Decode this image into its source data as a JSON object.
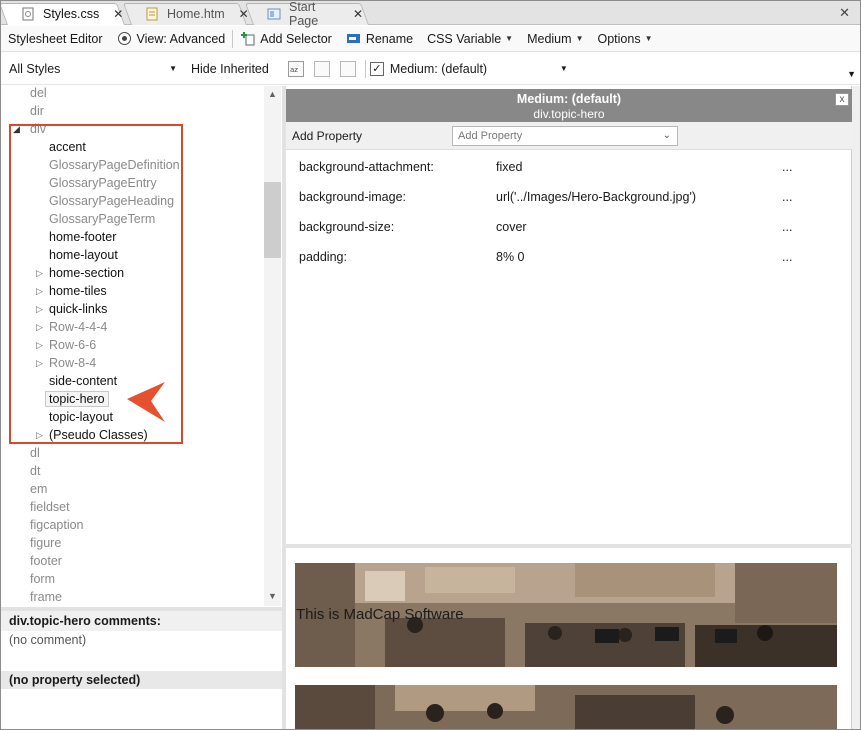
{
  "tabs": [
    {
      "label": "Styles.css",
      "close": "✕",
      "active": true
    },
    {
      "label": "Home.htm",
      "close": "✕",
      "active": false
    },
    {
      "label": "Start Page",
      "close": "✕",
      "active": false
    }
  ],
  "tabs_close_all": "✕",
  "toolbar": {
    "editor_label": "Stylesheet Editor",
    "view_label": "View: Advanced",
    "add_selector_label": "Add Selector",
    "rename_label": "Rename",
    "css_variable_label": "CSS Variable",
    "medium_label": "Medium",
    "options_label": "Options"
  },
  "filterbar": {
    "filter_value": "All Styles",
    "hide_inherited_label": "Hide Inherited",
    "medium_value": "Medium: (default)",
    "medium_checked": true
  },
  "tree": {
    "items_before": [
      "del",
      "dir"
    ],
    "expanded": "div",
    "children": [
      {
        "label": "accent",
        "muted": false,
        "expandable": false
      },
      {
        "label": "GlossaryPageDefinition",
        "muted": true,
        "expandable": false
      },
      {
        "label": "GlossaryPageEntry",
        "muted": true,
        "expandable": false
      },
      {
        "label": "GlossaryPageHeading",
        "muted": true,
        "expandable": false
      },
      {
        "label": "GlossaryPageTerm",
        "muted": true,
        "expandable": false
      },
      {
        "label": "home-footer",
        "muted": false,
        "expandable": false
      },
      {
        "label": "home-layout",
        "muted": false,
        "expandable": false
      },
      {
        "label": "home-section",
        "muted": false,
        "expandable": true
      },
      {
        "label": "home-tiles",
        "muted": false,
        "expandable": true
      },
      {
        "label": "quick-links",
        "muted": false,
        "expandable": true
      },
      {
        "label": "Row-4-4-4",
        "muted": true,
        "expandable": true
      },
      {
        "label": "Row-6-6",
        "muted": true,
        "expandable": true
      },
      {
        "label": "Row-8-4",
        "muted": true,
        "expandable": true
      },
      {
        "label": "side-content",
        "muted": false,
        "expandable": false
      },
      {
        "label": "topic-hero",
        "muted": false,
        "expandable": false,
        "selected": true
      },
      {
        "label": "topic-layout",
        "muted": false,
        "expandable": false
      },
      {
        "label": "(Pseudo Classes)",
        "muted": false,
        "expandable": true
      }
    ],
    "items_after": [
      "dl",
      "dt",
      "em",
      "fieldset",
      "figcaption",
      "figure",
      "footer",
      "form",
      "frame"
    ]
  },
  "comments": {
    "header": "div.topic-hero comments:",
    "text": "(no comment)",
    "property_selected": "(no property selected)"
  },
  "properties": {
    "header_title": "Medium: (default)",
    "header_selector": "div.topic-hero",
    "close": "x",
    "add_property_label": "Add Property",
    "add_property_placeholder": "Add Property",
    "rows": [
      {
        "name": "background-attachment:",
        "value": "fixed",
        "more": "..."
      },
      {
        "name": "background-image:",
        "value": "url('../Images/Hero-Background.jpg')",
        "more": "..."
      },
      {
        "name": "background-size:",
        "value": "cover",
        "more": "..."
      },
      {
        "name": "padding:",
        "value": "8% 0",
        "more": "..."
      }
    ]
  },
  "preview": {
    "hero_text": "This is MadCap Software"
  },
  "colors": {
    "highlight": "#d94a2c",
    "header_gray": "#888888"
  }
}
